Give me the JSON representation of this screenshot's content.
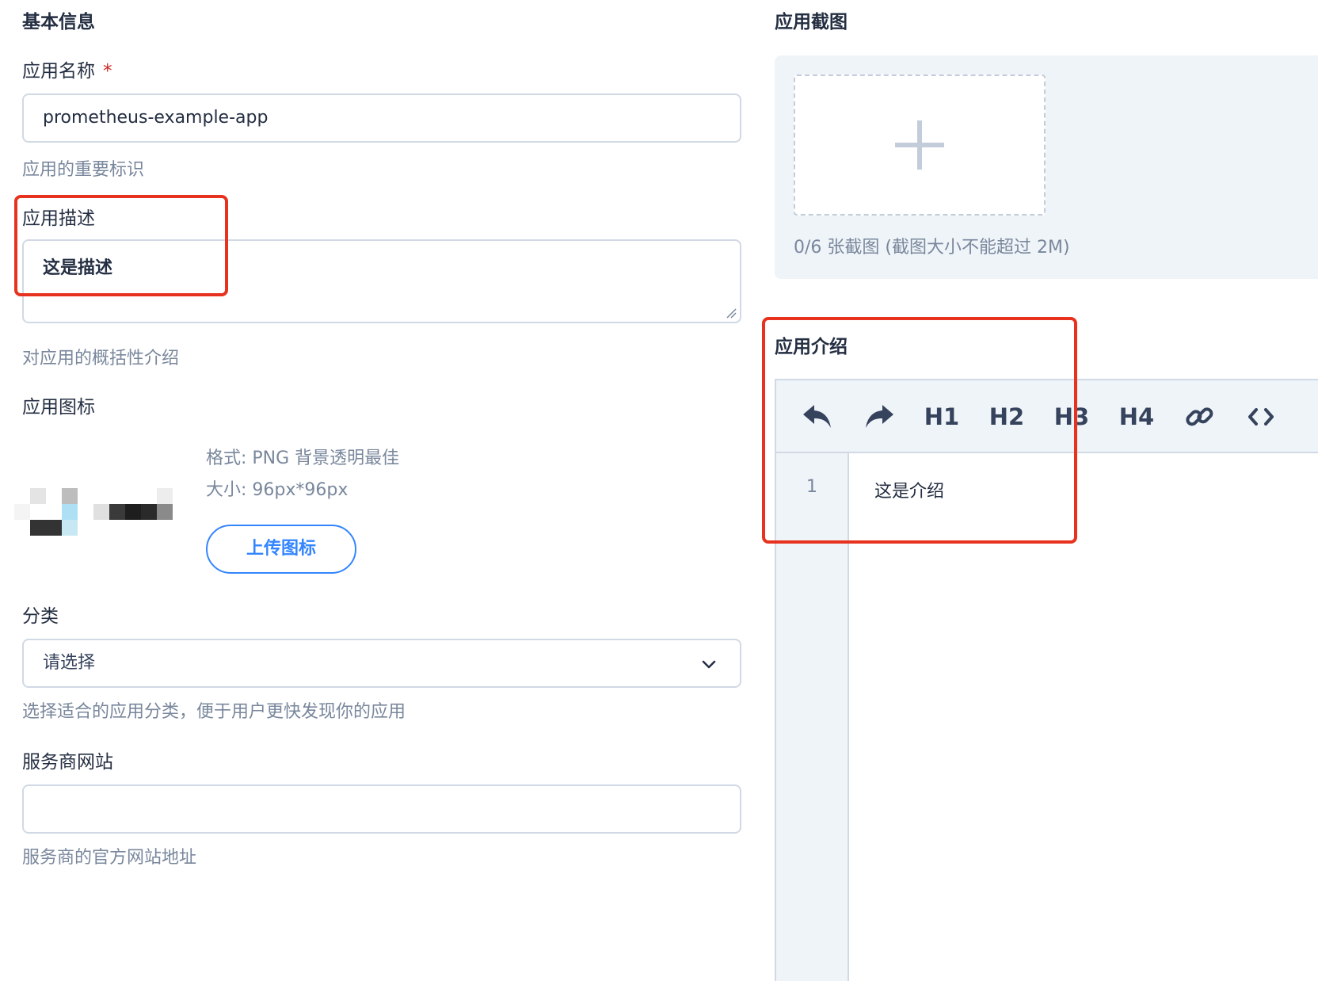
{
  "basic_info": {
    "title": "基本信息",
    "name": {
      "label": "应用名称",
      "required_mark": "*",
      "value": "prometheus-example-app",
      "hint": "应用的重要标识"
    },
    "description": {
      "label": "应用描述",
      "value": "这是描述",
      "hint": "对应用的概括性介绍"
    },
    "icon": {
      "label": "应用图标",
      "format_text": "格式: PNG 背景透明最佳",
      "size_text": "大小: 96px*96px",
      "upload_label": "上传图标"
    },
    "category": {
      "label": "分类",
      "selected": "请选择",
      "hint": "选择适合的应用分类，便于用户更快发现你的应用"
    },
    "website": {
      "label": "服务商网站",
      "value": "",
      "hint": "服务商的官方网站地址"
    }
  },
  "screenshots": {
    "title": "应用截图",
    "hint": "0/6 张截图 (截图大小不能超过 2M)"
  },
  "introduction": {
    "title": "应用介绍",
    "toolbar": {
      "undo_icon": "undo-icon",
      "redo_icon": "redo-icon",
      "h1": "H1",
      "h2": "H2",
      "h3": "H3",
      "h4": "H4",
      "link_icon": "link-icon",
      "code_icon": "code-icon"
    },
    "line_number": "1",
    "content": "这是介绍"
  },
  "colors": {
    "primary": "#3385ff",
    "highlight": "#e6321e",
    "required": "#ca2621"
  }
}
